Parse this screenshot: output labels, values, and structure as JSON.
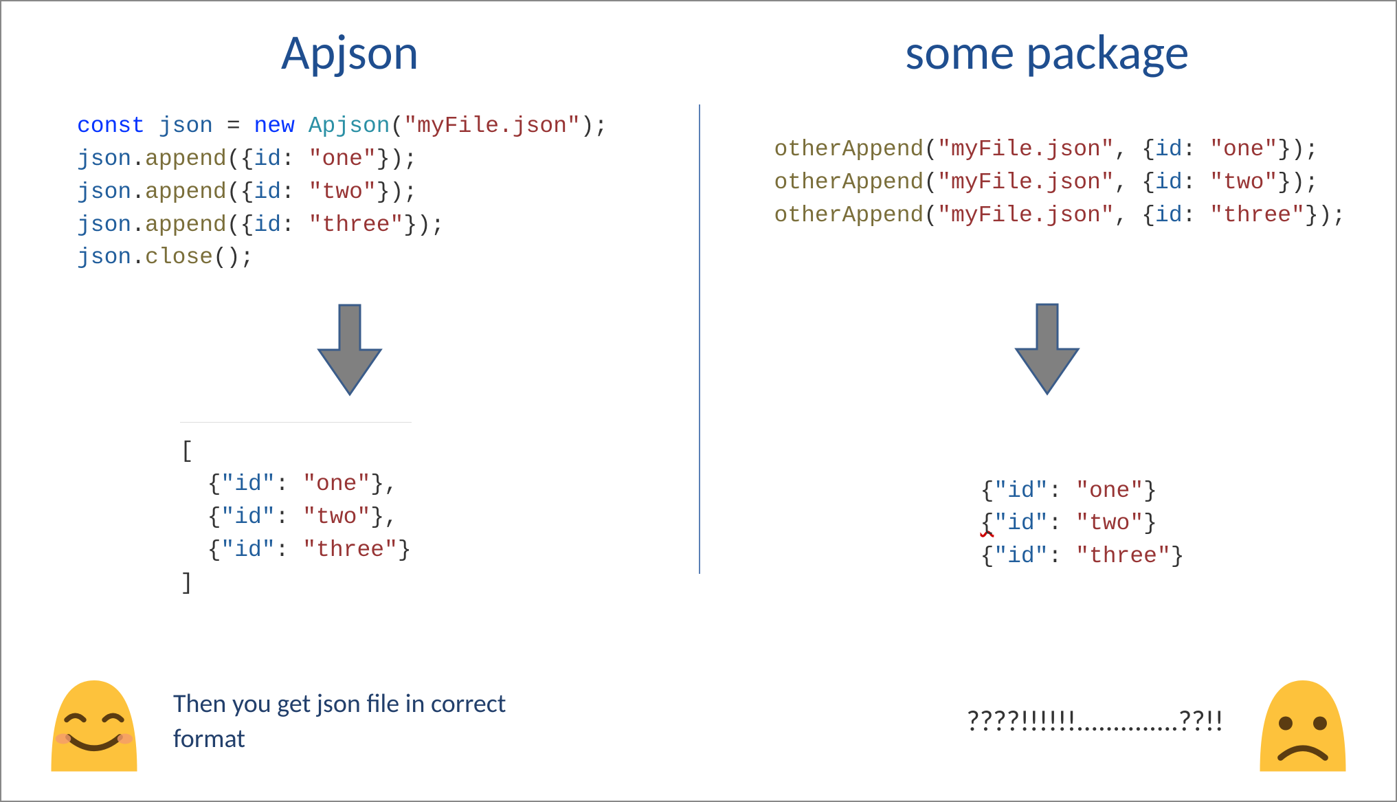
{
  "left": {
    "heading": "Apjson",
    "code": {
      "l1": {
        "kw1": "const",
        "var": "json",
        "eq": "=",
        "kw2": "new",
        "type": "Apjson",
        "open": "(",
        "str": "\"myFile.json\"",
        "close": ");"
      },
      "l2": {
        "var": "json",
        "dot": ".",
        "method": "append",
        "open": "(",
        "brace": "{",
        "key": "id",
        "colon": ":",
        "str": "\"one\"",
        "close": "});"
      },
      "l3": {
        "var": "json",
        "dot": ".",
        "method": "append",
        "open": "(",
        "brace": "{",
        "key": "id",
        "colon": ":",
        "str": "\"two\"",
        "close": "});"
      },
      "l4": {
        "var": "json",
        "dot": ".",
        "method": "append",
        "open": "(",
        "brace": "{",
        "key": "id",
        "colon": ":",
        "str": "\"three\"",
        "close": "});"
      },
      "l5": {
        "var": "json",
        "dot": ".",
        "method": "close",
        "paren": "();"
      }
    },
    "output": {
      "open": "[",
      "r1": {
        "open": "  {",
        "key": "\"id\"",
        "colon": ": ",
        "str": "\"one\"",
        "close": "},"
      },
      "r2": {
        "open": "  {",
        "key": "\"id\"",
        "colon": ": ",
        "str": "\"two\"",
        "close": "},"
      },
      "r3": {
        "open": "  {",
        "key": "\"id\"",
        "colon": ": ",
        "str": "\"three\"",
        "close": "}"
      },
      "close": "]"
    },
    "caption": "Then you get json file in correct format"
  },
  "right": {
    "heading": "some package",
    "code": {
      "l1": {
        "fn": "otherAppend",
        "open": "(",
        "str1": "\"myFile.json\"",
        "comma": ", ",
        "brace": "{",
        "key": "id",
        "colon": ": ",
        "str2": "\"one\"",
        "close": "});"
      },
      "l2": {
        "fn": "otherAppend",
        "open": "(",
        "str1": "\"myFile.json\"",
        "comma": ", ",
        "brace": "{",
        "key": "id",
        "colon": ": ",
        "str2": "\"two\"",
        "close": "});"
      },
      "l3": {
        "fn": "otherAppend",
        "open": "(",
        "str1": "\"myFile.json\"",
        "comma": ", ",
        "brace": "{",
        "key": "id",
        "colon": ": ",
        "str2": "\"three\"",
        "close": "});"
      }
    },
    "output": {
      "r1": {
        "open": "{",
        "key": "\"id\"",
        "colon": ": ",
        "str": "\"one\"",
        "close": "}"
      },
      "r2": {
        "open": "{",
        "key": "\"id\"",
        "colon": ": ",
        "str": "\"two\"",
        "close": "}"
      },
      "r3": {
        "open": "{",
        "key": "\"id\"",
        "colon": ": ",
        "str": "\"three\"",
        "close": "}"
      }
    },
    "caption": "????!!!!!!..............??!!"
  }
}
